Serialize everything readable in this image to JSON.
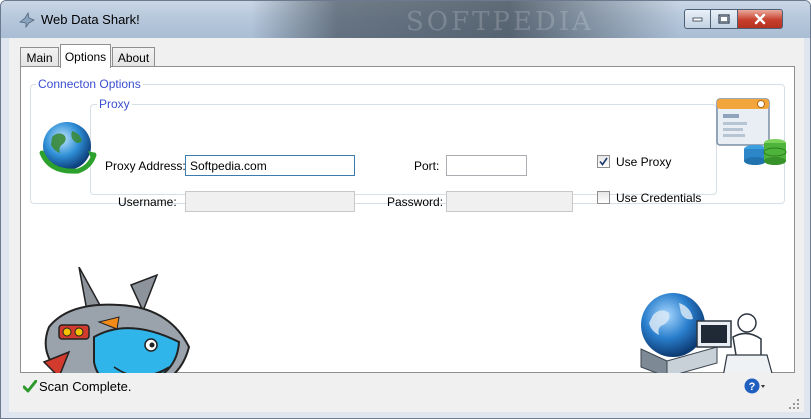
{
  "window": {
    "title": "Web Data Shark!",
    "watermark": "SOFTPEDIA"
  },
  "tabs": [
    {
      "label": "Main",
      "active": false
    },
    {
      "label": "Options",
      "active": true
    },
    {
      "label": "About",
      "active": false
    }
  ],
  "connection_group": {
    "title": "Connecton Options",
    "proxy_group": {
      "title": "Proxy",
      "proxy_address_label": "Proxy Address:",
      "proxy_address_value": "Softpedia.com",
      "port_label": "Port:",
      "port_value": "",
      "username_label": "Username:",
      "username_value": "",
      "password_label": "Password:",
      "password_value": ""
    },
    "use_proxy": {
      "label": "Use Proxy",
      "checked": true
    },
    "use_credentials": {
      "label": "Use Credentials",
      "checked": false
    }
  },
  "status": {
    "text": "Scan Complete."
  },
  "colors": {
    "group_title": "#3a4fd0",
    "status_check": "#2e9a2e",
    "help_icon": "#1f5fbf"
  },
  "icons": {
    "app": "shark-icon",
    "globe": "globe-refresh-icon",
    "database": "database-window-icon",
    "shark_mascot": "shark-mascot",
    "network_user": "network-user-icon",
    "status": "checkmark-icon",
    "help": "help-icon"
  }
}
